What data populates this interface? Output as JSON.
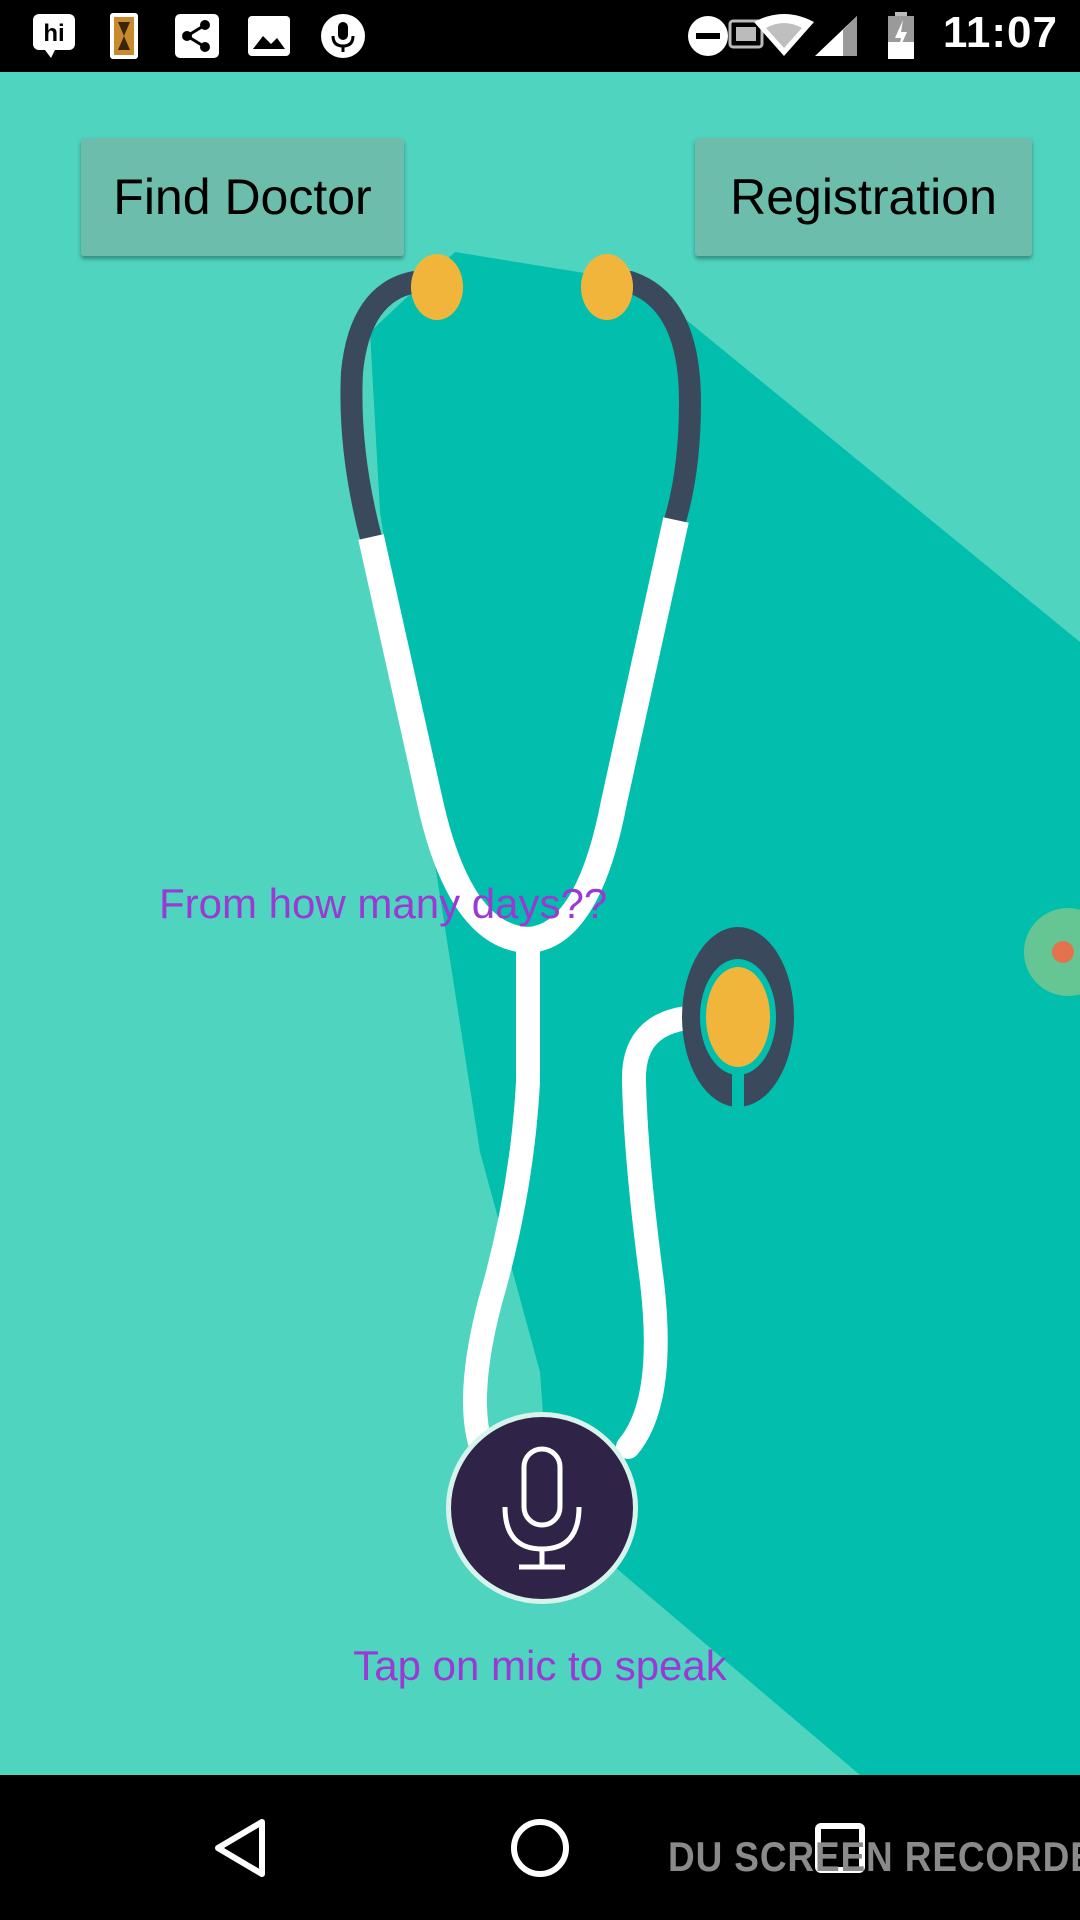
{
  "status_bar": {
    "time": "11:07",
    "icons": [
      "hi-messenger-icon",
      "hourglass-app-icon",
      "share-icon",
      "gallery-icon",
      "mic-recording-icon",
      "do-not-disturb-icon",
      "cast-icon",
      "wifi-icon",
      "signal-icon",
      "battery-charging-icon"
    ]
  },
  "toolbar": {
    "find_doctor_label": "Find Doctor",
    "registration_label": "Registration"
  },
  "main": {
    "prompt_text": "From how many days??",
    "hint_text": "Tap on mic to speak",
    "mic_icon": "microphone-icon"
  },
  "nav_bar": {
    "back_icon": "back-triangle-icon",
    "home_icon": "home-circle-icon",
    "recents_icon": "recents-square-icon",
    "watermark": "DU SCREEN RECORDER"
  },
  "colors": {
    "background": "#4fd5bf",
    "shadow": "#02bfad",
    "button": "#6dbdad",
    "text_accent": "#9a39d3",
    "mic_background": "#2f2448",
    "tube_dark": "#3a4a5c",
    "earpiece": "#f2b53b"
  }
}
